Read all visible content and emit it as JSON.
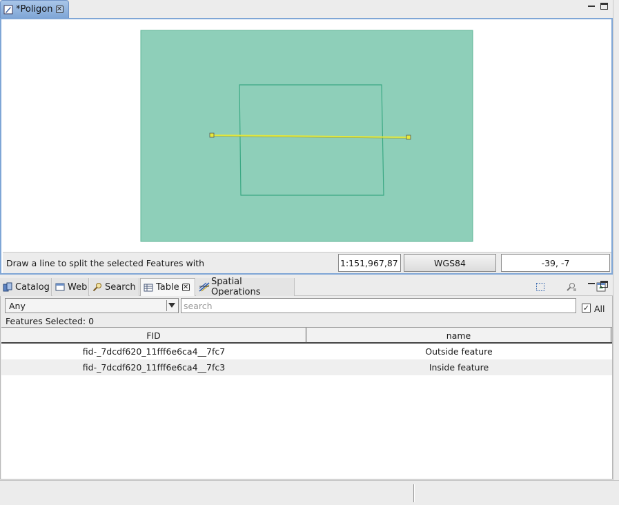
{
  "editor": {
    "tab_label": "*Poligon"
  },
  "map": {
    "colors": {
      "feature_fill": "#8ecfb9",
      "feature_stroke": "#3aa883",
      "split_line": "#e2e63a"
    }
  },
  "status": {
    "message": "Draw a line to split the selected Features with",
    "scale": "1:151,967,87",
    "crs": "WGS84",
    "coords": "-39, -7"
  },
  "views": {
    "tabs": [
      {
        "label": "Catalog",
        "icon": "catalog-icon"
      },
      {
        "label": "Web",
        "icon": "web-icon"
      },
      {
        "label": "Search",
        "icon": "search-icon"
      },
      {
        "label": "Table",
        "icon": "table-icon"
      },
      {
        "label": "Spatial Operations",
        "icon": "spatial-operations-icon"
      }
    ]
  },
  "table": {
    "filter_value": "Any",
    "search_placeholder": "search",
    "all_label": "All",
    "all_checked": true,
    "selected_text": "Features Selected: 0",
    "columns": [
      "FID",
      "name"
    ],
    "rows": [
      {
        "fid": "fid-_7dcdf620_11fff6e6ca4__7fc7",
        "name": "Outside feature"
      },
      {
        "fid": "fid-_7dcdf620_11fff6e6ca4__7fc3",
        "name": "Inside feature"
      }
    ]
  }
}
